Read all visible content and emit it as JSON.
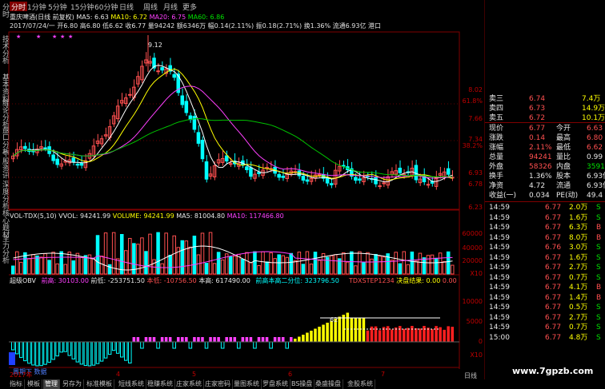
{
  "side_tabs": [
    "分时",
    "技术分析",
    "基本资料",
    "缠论分析",
    "盘口分析",
    "个股资讯",
    "深度分析",
    "核心题材",
    "主力分析"
  ],
  "toolbar": {
    "periods": [
      "分时",
      "1分钟",
      "5分钟",
      "15分钟",
      "60分钟",
      "日线",
      "周线",
      "月线",
      "更多"
    ],
    "active": "分时"
  },
  "header": {
    "stock": "重庆啤酒(日线 前复权)",
    "ma5": "MA5: 6.63",
    "ma10": "MA10: 6.72",
    "ma20": "MA20: 6.75",
    "ma60": "MA60: 6.86",
    "line2": "2017/07/24/一 开6.80 高6.80 低6.62 收6.77 量94242 额6346万 幅0.14(2.11%) 振0.18(2.71%) 换1.36% 流通6.93亿 港口"
  },
  "price_axis": [
    "8.02",
    "61.8%",
    "7.66",
    "7.34",
    "38.2%",
    "6.93",
    "6.78",
    "6.23"
  ],
  "peak_label": "9.12",
  "vol_header": {
    "name": "VOL-TDX(5,10)",
    "vvol": "VVOL: 94241.99",
    "volume": "VOLUME: 94241.99",
    "ma5": "MA5: 81004.80",
    "ma10": "MA10: 117466.80"
  },
  "vol_axis": [
    "60000",
    "40000",
    "20000",
    "X10"
  ],
  "obv_header": {
    "name": "超级OBV",
    "a": "前高: 30103.00",
    "b": "前低: -253751.50",
    "c": "本低: -10756.50",
    "d": "本高: 617490.00",
    "e": "前高本高二分位: 323796.50",
    "f": "TDXSTEP1234",
    "g": "决盘结果: 0.00",
    "h": "0.00"
  },
  "obv_axis": [
    "10000",
    "5000",
    "0",
    "X10"
  ],
  "obv_label": "62",
  "date_axis": [
    "2017年",
    "4",
    "5",
    "6",
    "7"
  ],
  "chip_label": "周期下 数据",
  "quotes": {
    "asks": [
      {
        "label": "卖三",
        "price": "6.74",
        "vol": "7.4万"
      },
      {
        "label": "卖四",
        "price": "6.73",
        "vol": "14.9万"
      },
      {
        "label": "卖五",
        "price": "6.72",
        "vol": "10.1万"
      }
    ],
    "stats": [
      {
        "l1": "现价",
        "v1": "6.77",
        "l2": "今开",
        "v2": "6.63"
      },
      {
        "l1": "涨跌",
        "v1": "0.14",
        "l2": "最高",
        "v2": "6.80"
      },
      {
        "l1": "涨幅",
        "v1": "2.11%",
        "l2": "最低",
        "v2": "6.62"
      },
      {
        "l1": "总量",
        "v1": "94241",
        "l2": "量比",
        "v2": "0.99"
      },
      {
        "l1": "外盘",
        "v1": "58326",
        "l2": "内盘",
        "v2": "35915"
      },
      {
        "l1": "换手",
        "v1": "1.36%",
        "l2": "股本",
        "v2": "6.93亿"
      },
      {
        "l1": "净资",
        "v1": "4.72",
        "l2": "流通",
        "v2": "6.93亿"
      },
      {
        "l1": "收益(一)",
        "v1": "0.034",
        "l2": "PE(动)",
        "v2": "49.4"
      }
    ],
    "trades": [
      {
        "t": "14:59",
        "p": "6.77",
        "v": "2.0万",
        "s": "S"
      },
      {
        "t": "14:59",
        "p": "6.77",
        "v": "1.6万",
        "s": "S"
      },
      {
        "t": "14:59",
        "p": "6.77",
        "v": "6.3万",
        "s": "B"
      },
      {
        "t": "14:59",
        "p": "6.77",
        "v": "8.0万",
        "s": "B"
      },
      {
        "t": "14:59",
        "p": "6.76",
        "v": "3.0万",
        "s": "S"
      },
      {
        "t": "14:59",
        "p": "6.77",
        "v": "1.6万",
        "s": "S"
      },
      {
        "t": "14:59",
        "p": "6.77",
        "v": "2.7万",
        "s": "S"
      },
      {
        "t": "14:59",
        "p": "6.77",
        "v": "0.7万",
        "s": "S"
      },
      {
        "t": "14:59",
        "p": "6.77",
        "v": "4.1万",
        "s": "B"
      },
      {
        "t": "14:59",
        "p": "6.77",
        "v": "1.4万",
        "s": "B"
      },
      {
        "t": "14:59",
        "p": "6.77",
        "v": "0.5万",
        "s": "S"
      },
      {
        "t": "14:59",
        "p": "6.77",
        "v": "2.7万",
        "s": "S"
      },
      {
        "t": "14:59",
        "p": "6.77",
        "v": "0.7万",
        "s": "S"
      },
      {
        "t": "15:00",
        "p": "6.77",
        "v": "4.8万",
        "s": "S"
      }
    ]
  },
  "bottom_tabs": [
    "指标",
    "模板",
    "管理",
    "另存为",
    "标准模板",
    "短线系统",
    "稳赚系统",
    "庄家系统",
    "庄家密码",
    "量图系统",
    "罗盘系统",
    "BS操盘",
    "桑盛操盘",
    "金股系统"
  ],
  "bottom_active": "管理",
  "right_tab": "日线",
  "watermark": "www.7gpzb.com",
  "colors": {
    "up": "#ff5050",
    "down": "#00ffff",
    "ma5": "#ffffff",
    "ma10": "#ffff00",
    "ma20": "#ff40ff",
    "ma60": "#00c000"
  }
}
